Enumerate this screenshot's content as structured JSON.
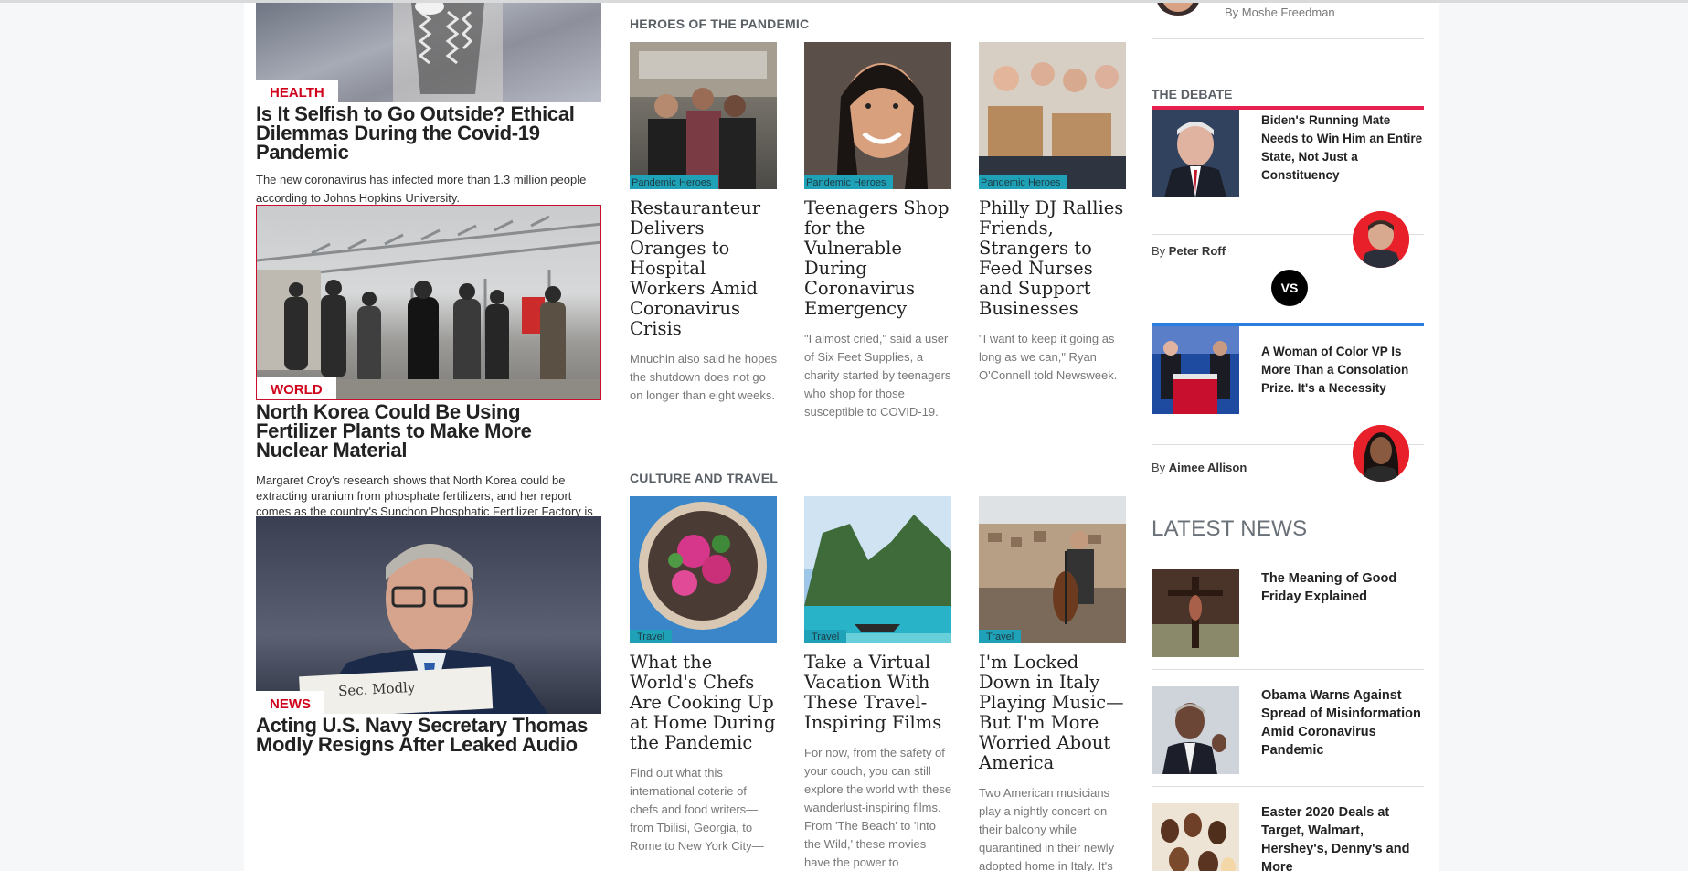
{
  "left_column": {
    "articles": [
      {
        "tag": "HEALTH",
        "headline": "Is It Selfish to Go Outside? Ethical Dilemmas During the Covid-19 Pandemic",
        "description": "The new coronavirus has infected more than 1.3 million people according to Johns Hopkins University."
      },
      {
        "tag": "WORLD",
        "headline": "North Korea Could Be Using Fertilizer Plants to Make More Nuclear Material",
        "description": "Margaret Croy's research shows that North Korea could be extracting uranium from phosphate fertilizers, and her report comes as the country's Sunchon Phosphatic Fertilizer Factory is reportedly \"on the eve of completion.\""
      },
      {
        "tag": "NEWS",
        "headline": "Acting U.S. Navy Secretary Thomas Modly Resigns After Leaked Audio",
        "image_text": "Sec. Modly"
      }
    ]
  },
  "heroes": {
    "section_title": "HEROES OF THE PANDEMIC",
    "cards": [
      {
        "badge": "Pandemic Heroes",
        "title": "Restauranteur Delivers Oranges to Hospital Workers Amid Coronavirus Crisis",
        "description": "Mnuchin also said he hopes the shutdown does not go on longer than eight weeks."
      },
      {
        "badge": "Pandemic Heroes",
        "title": "Teenagers Shop for the Vulnerable During Coronavirus Emergency",
        "description": "\"I almost cried,\" said a user of Six Feet Supplies, a charity started by teenagers who shop for those susceptible to COVID-19."
      },
      {
        "badge": "Pandemic Heroes",
        "title": "Philly DJ Rallies Friends, Strangers to Feed Nurses and Support Businesses",
        "description": "\"I want to keep it going as long as we can,\" Ryan O'Connell told Newsweek."
      }
    ]
  },
  "culture": {
    "section_title": "CULTURE AND TRAVEL",
    "cards": [
      {
        "badge": "Travel",
        "title": "What the World's Chefs Are Cooking Up at Home During the Pandemic",
        "description": "Find out what this international coterie of chefs and food writers—from Tbilisi, Georgia, to Rome to New York City—"
      },
      {
        "badge": "Travel",
        "title": "Take a Virtual Vacation With These Travel-Inspiring Films",
        "description": "For now, from the safety of your couch, you can still explore the world with these wanderlust-inspiring films. From 'The Beach' to 'Into the Wild,' these movies have the power to"
      },
      {
        "badge": "Travel",
        "title": "I'm Locked Down in Italy Playing Music—But I'm More Worried About America",
        "description": "Two American musicians play a nightly concert on their balcony while quarantined in their newly adopted home in Italy. It's"
      }
    ]
  },
  "right_column": {
    "top_byline": "By Moshe Freedman",
    "debate": {
      "title": "THE DEBATE",
      "vs_label": "VS",
      "by_prefix": "By",
      "items": [
        {
          "title": "Biden's Running Mate Needs to Win Him an Entire State, Not Just a Constituency",
          "author": "Peter Roff",
          "bar_color": "#e8204f"
        },
        {
          "title": "A Woman of Color VP Is More Than a Consolation Prize. It's a Necessity",
          "author": "Aimee Allison",
          "bar_color": "#2a7de1"
        }
      ]
    },
    "latest": {
      "title": "LATEST NEWS",
      "items": [
        {
          "title": "The Meaning of Good Friday Explained"
        },
        {
          "title": "Obama Warns Against Spread of Misinformation Amid Coronavirus Pandemic"
        },
        {
          "title": "Easter 2020 Deals at Target, Walmart, Hershey's, Denny's and More"
        }
      ]
    }
  }
}
